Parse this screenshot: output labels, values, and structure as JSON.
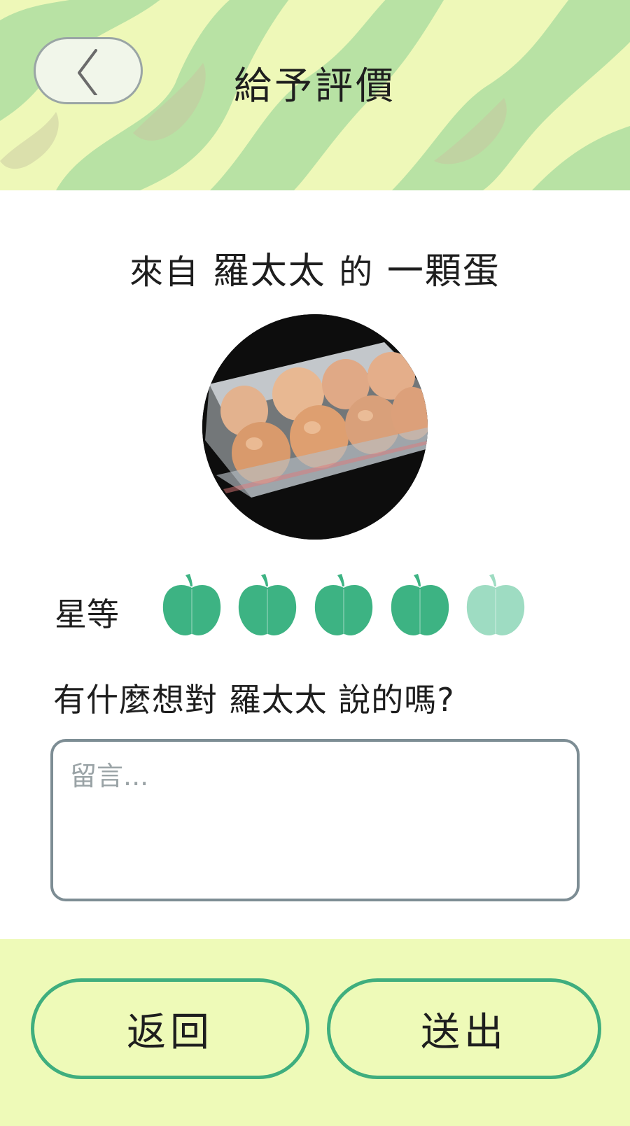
{
  "header": {
    "title": "給予評價",
    "back_icon": "chevron-left-icon"
  },
  "product": {
    "prefix": "來自",
    "seller": "羅太太",
    "connector": "的",
    "name": "一顆蛋",
    "photo": "egg-carton-photo"
  },
  "rating": {
    "label": "星等",
    "icon": "apple-icon",
    "value": 4,
    "max": 5,
    "active_color": "#3db383",
    "inactive_color": "#9edcc2"
  },
  "comment": {
    "prompt": "有什麼想對 羅太太 說的嗎?",
    "placeholder": "留言...",
    "value": ""
  },
  "footer": {
    "back_label": "返回",
    "submit_label": "送出"
  },
  "colors": {
    "header_bg": "#eef8b8",
    "footer_bg": "#eefab8",
    "accent": "#3fae7e"
  }
}
